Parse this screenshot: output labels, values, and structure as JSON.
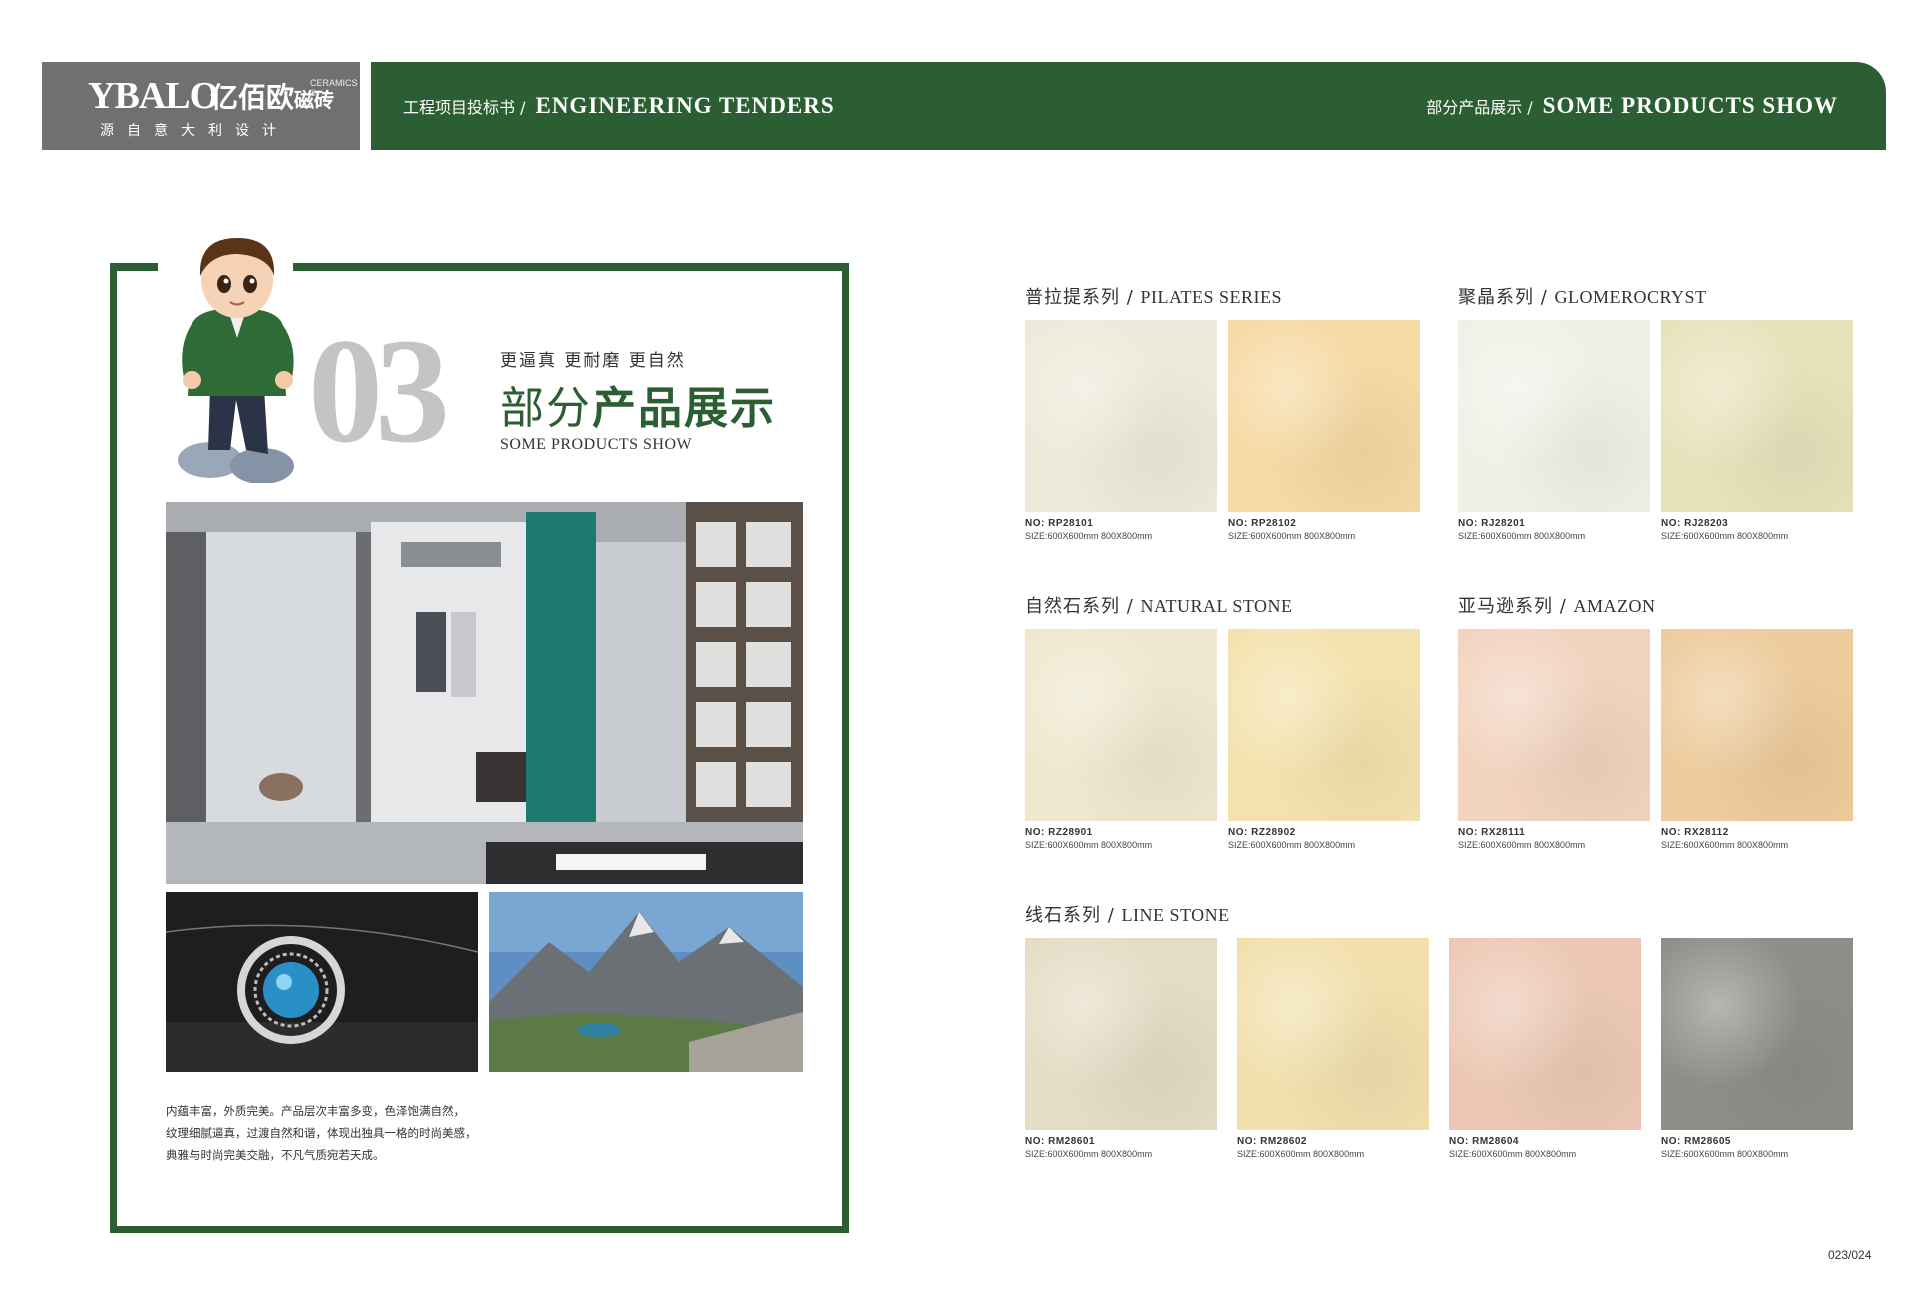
{
  "header": {
    "logo_text": "YBALO",
    "logo_cn": "亿佰欧",
    "logo_cn_small": "磁砖",
    "logo_reg": "CERAMICS ®",
    "logo_slogan": "源自意大利设计",
    "left_cn": "工程项目投标书 /",
    "left_en": "ENGINEERING TENDERS",
    "right_cn": "部分产品展示 /",
    "right_en": "SOME PRODUCTS SHOW",
    "brand_color": "#2c5e33"
  },
  "panel": {
    "number": "03",
    "tagline": "更逼真  更耐磨  更自然",
    "title_cn_light": "部分",
    "title_cn_bold": "产品展示",
    "title_en": "SOME PRODUCTS SHOW",
    "description": [
      "内蕴丰富，外质完美。产品层次丰富多变，色泽饱满自然，",
      "纹理细腻逼真，过渡自然和谐，体现出独具一格的时尚美感，",
      "典雅与时尚完美交融，不凡气质宛若天成。"
    ]
  },
  "series": [
    {
      "cn": "普拉提系列",
      "en": "PILATES SERIES",
      "tiles": [
        {
          "no": "NO: RP28101",
          "size": "SIZE:600X600mm  800X800mm",
          "color": "#ecead9"
        },
        {
          "no": "NO: RP28102",
          "size": "SIZE:600X600mm  800X800mm",
          "color": "#f6d9a3"
        }
      ]
    },
    {
      "cn": "聚晶系列",
      "en": "GLOMEROCRYST",
      "tiles": [
        {
          "no": "NO: RJ28201",
          "size": "SIZE:600X600mm  800X800mm",
          "color": "#f1f0e7"
        },
        {
          "no": "NO: RJ28203",
          "size": "SIZE:600X600mm  800X800mm",
          "color": "#e7e2bb"
        }
      ]
    },
    {
      "cn": "自然石系列",
      "en": "NATURAL STONE",
      "tiles": [
        {
          "no": "NO: RZ28901",
          "size": "SIZE:600X600mm  800X800mm",
          "color": "#efe8cf"
        },
        {
          "no": "NO: RZ28902",
          "size": "SIZE:600X600mm  800X800mm",
          "color": "#f4e2ad"
        }
      ]
    },
    {
      "cn": "亚马逊系列",
      "en": "AMAZON",
      "tiles": [
        {
          "no": "NO: RX28111",
          "size": "SIZE:600X600mm  800X800mm",
          "color": "#f2d3bf"
        },
        {
          "no": "NO: RX28112",
          "size": "SIZE:600X600mm  800X800mm",
          "color": "#edcb9c"
        }
      ]
    },
    {
      "cn": "线石系列",
      "en": "LINE STONE",
      "tiles": [
        {
          "no": "NO: RM28601",
          "size": "SIZE:600X600mm  800X800mm",
          "color": "#e5dcc5"
        },
        {
          "no": "NO: RM28602",
          "size": "SIZE:600X600mm  800X800mm",
          "color": "#f1e0ad"
        },
        {
          "no": "NO: RM28604",
          "size": "SIZE:600X600mm  800X800mm",
          "color": "#ecc8b4"
        },
        {
          "no": "NO: RM28605",
          "size": "SIZE:600X600mm  800X800mm",
          "color": "#8e8e88"
        }
      ]
    }
  ],
  "page_number": "023/024"
}
